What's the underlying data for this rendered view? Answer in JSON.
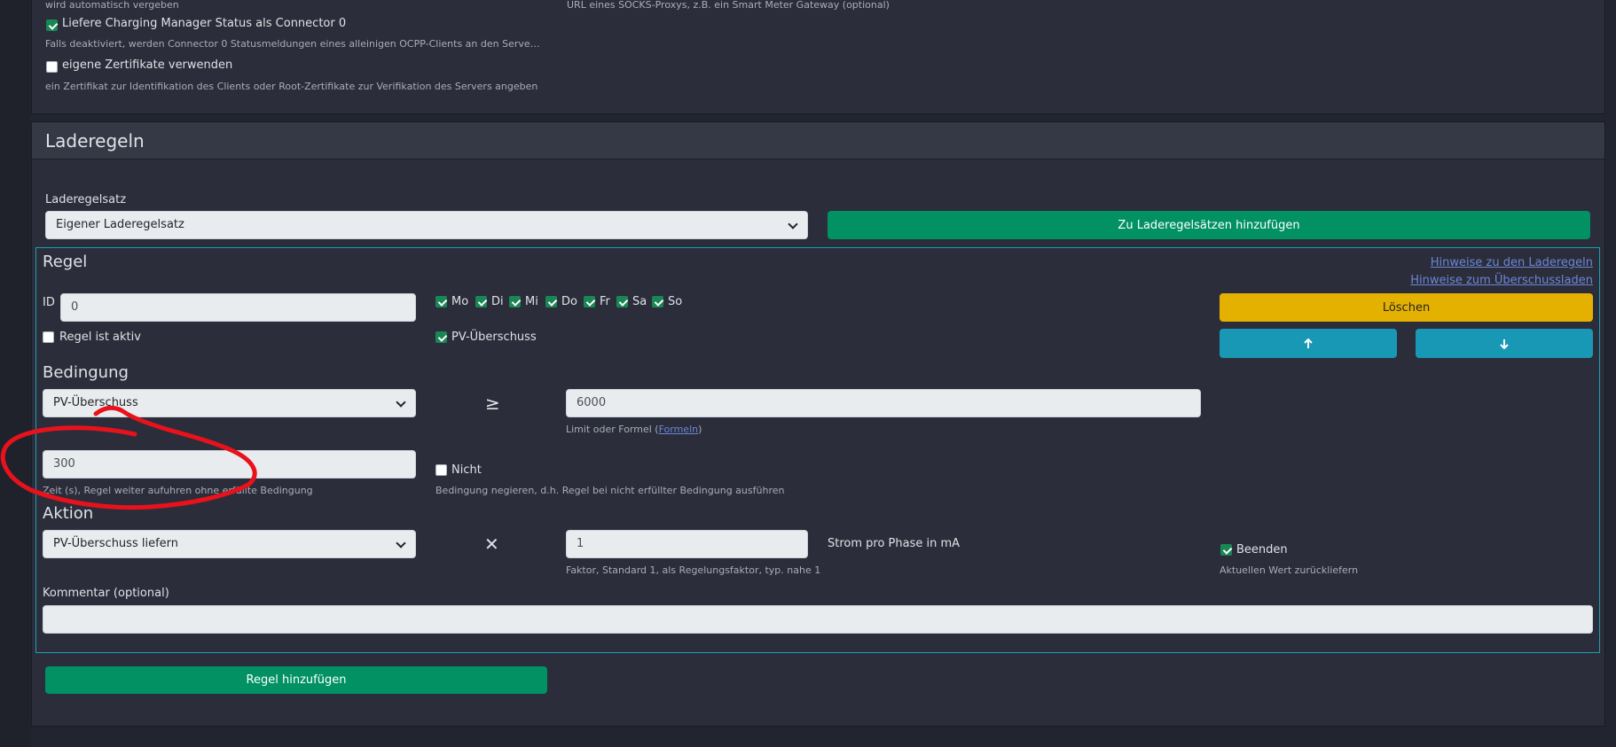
{
  "top_card": {
    "line1_left": "wird automatisch vergeben",
    "line1_right": "URL eines SOCKS-Proxys, z.B. ein Smart Meter Gateway (optional)",
    "cm_status_label": "Liefere Charging Manager Status als Connector 0",
    "cm_status_checked": true,
    "cm_status_help": "Falls deaktiviert, werden Connector 0 Statusmeldungen eines alleinigen OCPP-Clients an den Server durc…",
    "certs_label": "eigene Zertifikate verwenden",
    "certs_checked": false,
    "certs_help": "ein Zertifikat zur Identifikation des Clients oder Root-Zertifikate zur Verifikation des Servers angeben"
  },
  "section": {
    "title": "Laderegeln",
    "ruleset_label": "Laderegelsatz",
    "ruleset_value": "Eigener Laderegelsatz",
    "add_to_rulesets_button": "Zu Laderegelsätzen hinzufügen"
  },
  "rule": {
    "title": "Regel",
    "hint_link_1": "Hinweise zu den Laderegeln",
    "hint_link_2": "Hinweise zum Überschussladen",
    "id_label": "ID",
    "id_value": "0",
    "days": [
      {
        "label": "Mo",
        "checked": true
      },
      {
        "label": "Di",
        "checked": true
      },
      {
        "label": "Mi",
        "checked": true
      },
      {
        "label": "Do",
        "checked": true
      },
      {
        "label": "Fr",
        "checked": true
      },
      {
        "label": "Sa",
        "checked": true
      },
      {
        "label": "So",
        "checked": true
      }
    ],
    "delete_button": "Löschen",
    "up_icon": "arrow-up-icon",
    "down_icon": "arrow-down-icon",
    "active_label": "Regel ist aktiv",
    "active_checked": false,
    "pv_label": "PV-Überschuss",
    "pv_checked": true
  },
  "condition": {
    "title": "Bedingung",
    "source_value": "PV-Überschuss",
    "operator": "≥",
    "limit_value": "6000",
    "limit_help_prefix": "Limit oder Formel (",
    "limit_help_link": "Formeln",
    "limit_help_suffix": ")",
    "time_value": "300",
    "time_help": "Zeit (s), Regel weiter aufuhren ohne erfüllte Bedingung",
    "not_label": "Nicht",
    "not_checked": false,
    "not_help": "Bedingung negieren, d.h. Regel bei nicht erfüllter Bedingung ausführen"
  },
  "action": {
    "title": "Aktion",
    "type_value": "PV-Überschuss liefern",
    "operator": "✕",
    "factor_value": "1",
    "factor_help": "Faktor, Standard 1, als Regelungsfaktor, typ. nahe 1",
    "unit_label": "Strom pro Phase in mA",
    "end_label": "Beenden",
    "end_checked": true,
    "end_help": "Aktuellen Wert zurückliefern"
  },
  "comment": {
    "label": "Kommentar (optional)",
    "value": ""
  },
  "add_rule_button": "Regel hinzufügen",
  "colors": {
    "background": "#222530",
    "card": "#2b2d3a",
    "green": "#019163",
    "yellow": "#e5b100",
    "teal": "#1898b5",
    "annotation": "#e8121c"
  }
}
